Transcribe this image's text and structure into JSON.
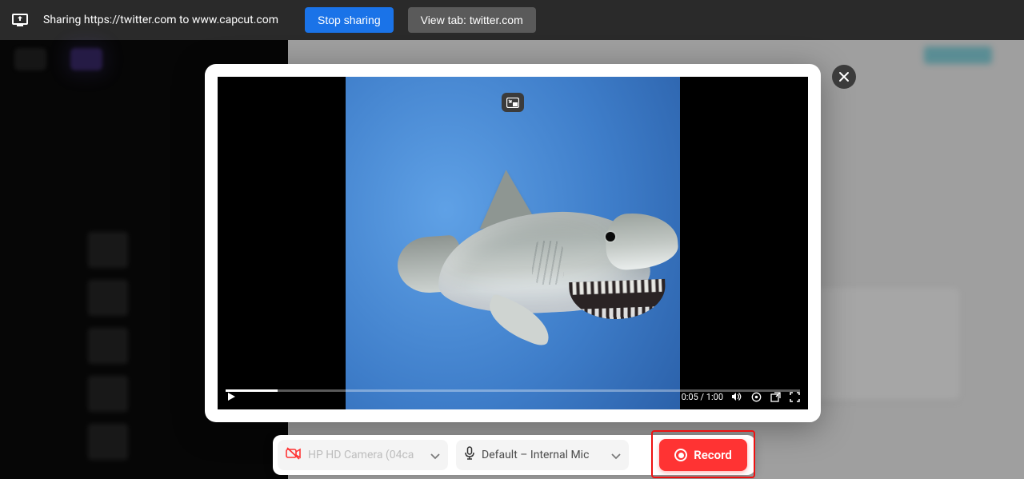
{
  "share_bar": {
    "text": "Sharing https://twitter.com to www.capcut.com",
    "stop_label": "Stop sharing",
    "view_label": "View tab: twitter.com"
  },
  "video": {
    "current_time": "0:05",
    "duration": "1:00",
    "time_display": "0:05 / 1:00",
    "progress_pct": 9
  },
  "devices": {
    "camera_disabled": true,
    "camera_label": "HP HD Camera (04ca",
    "mic_label": "Default – Internal Mic"
  },
  "record": {
    "label": "Record"
  },
  "colors": {
    "primary_blue": "#1a73e8",
    "record_red": "#ff3333",
    "highlight_red": "#ee1111"
  }
}
